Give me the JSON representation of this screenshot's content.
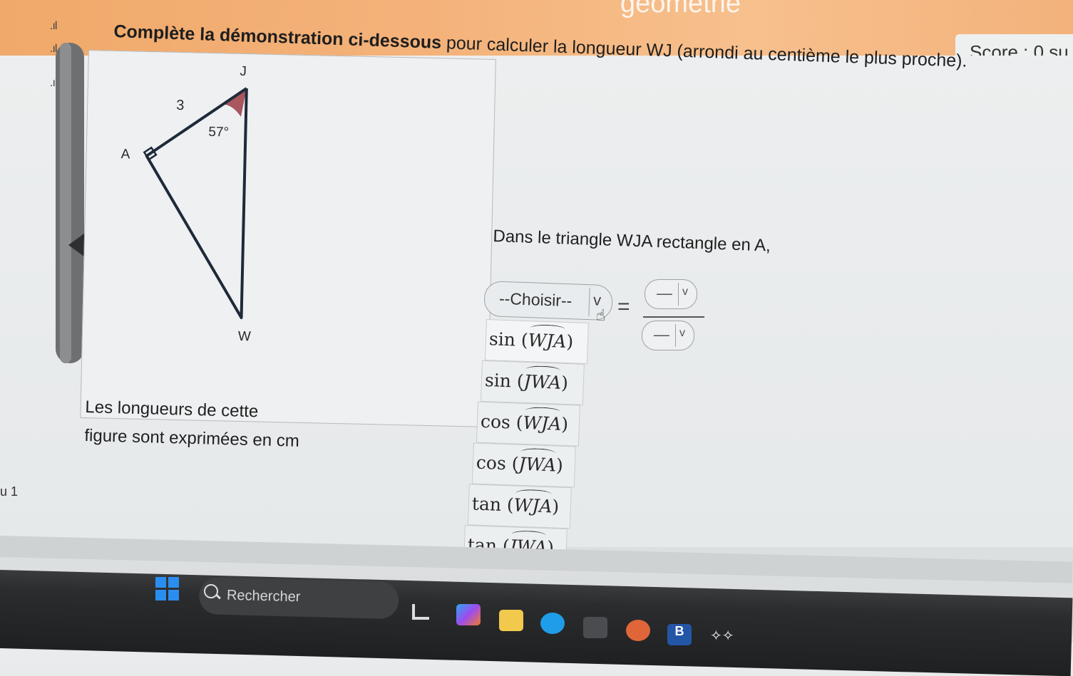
{
  "banner": {
    "title": "géométrie"
  },
  "score": {
    "text": "Score : 0 su"
  },
  "signal_icons": [
    "signal-bars-icon",
    "signal-bars-icon",
    "signal-bars-icon"
  ],
  "instruction": {
    "bold": "Complète la démonstration ci-dessous",
    "rest": " pour calculer la longueur WJ (arrondi au centième le plus proche)."
  },
  "figure": {
    "vertex_J": "J",
    "vertex_A": "A",
    "vertex_W": "W",
    "side_AJ": "3",
    "angle_J": "57°",
    "angle_color": "#a9565f"
  },
  "units_note": {
    "line1": "Les longueurs de cette",
    "line2": "figure sont exprimées en cm"
  },
  "triangle_context": "Dans le triangle WJA rectangle en A,",
  "ratio_select": {
    "label": "--Choisir--",
    "chevron": "v"
  },
  "equals": "=",
  "numerator_select": {
    "value": "—",
    "chevron": "v"
  },
  "denominator_select": {
    "value": "—",
    "chevron": "v"
  },
  "menu": [
    {
      "fn": "sin",
      "arg": "WJA"
    },
    {
      "fn": "sin",
      "arg": "JWA"
    },
    {
      "fn": "cos",
      "arg": "WJA"
    },
    {
      "fn": "cos",
      "arg": "JWA"
    },
    {
      "fn": "tan",
      "arg": "WJA"
    },
    {
      "fn": "tan",
      "arg": "JWA"
    }
  ],
  "side_label": "u 1",
  "taskbar": {
    "search_text": "Rechercher",
    "icons": [
      "windows-start-icon",
      "search-icon",
      "file-explorer-icon",
      "copilot-icon",
      "folder-icon",
      "edge-icon",
      "store-icon",
      "firefox-icon",
      "b-app-icon",
      "dropbox-icon"
    ],
    "accent": "#2a8ef0"
  }
}
